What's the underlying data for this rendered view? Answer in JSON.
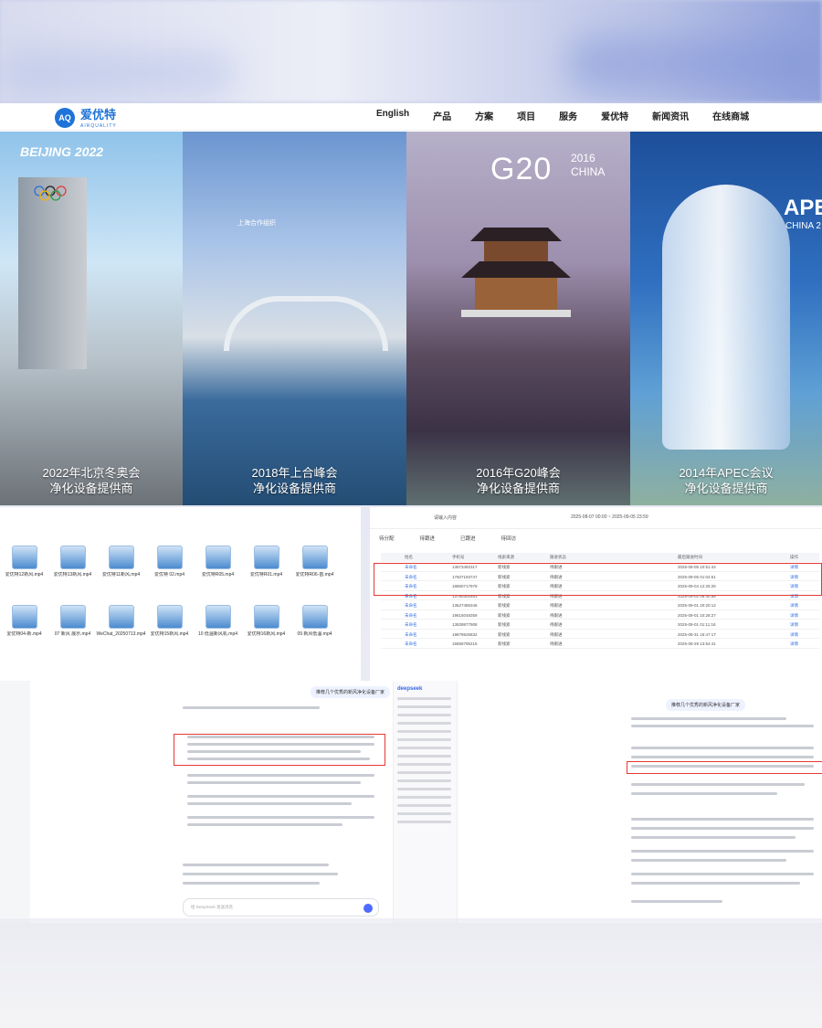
{
  "site": {
    "logo_name": "爱优特",
    "logo_sub": "AIRQUALITY",
    "logo_mark": "AQ",
    "menu": [
      "English",
      "产品",
      "方案",
      "项目",
      "服务",
      "爱优特",
      "新闻资讯",
      "在线商城"
    ]
  },
  "panels": [
    {
      "badge": "BEIJING 2022",
      "line1": "2022年北京冬奥会",
      "line2": "净化设备提供商"
    },
    {
      "badge": "上海合作组织",
      "line1": "2018年上合峰会",
      "line2": "净化设备提供商"
    },
    {
      "badge": "G20",
      "badge2": "2016 CHINA",
      "line1": "2016年G20峰会",
      "line2": "净化设备提供商"
    },
    {
      "badge": "APEC",
      "badge2": "CHINA 2",
      "line1": "2014年APEC会议",
      "line2": "净化设备提供商"
    }
  ],
  "files": [
    "爱优特12新风.mp4",
    "爱优特13新风.mp4",
    "爱优特11新风.mp4",
    "爱优特 02.mp4",
    "爱优特R05.mp4",
    "爱优特R01.mp4",
    "爱优特R06-首.mp4",
    "爱优特04-新.mp4",
    "07 新风 展示.mp4",
    "WeChat_20250713.mp4",
    "爱优特15新风.mp4",
    "10 低温新风机.mp4",
    "爱优特16新风.mp4",
    "09 新风低温.mp4"
  ],
  "crm": {
    "search_placeholder": "请输入内容",
    "date_range": "2025-08-07 00:00 ~ 2025-09-05 23:59",
    "tabs": [
      "待分配",
      "待跟进",
      "已跟进",
      "待回访"
    ],
    "columns": [
      "姓名",
      "手机号",
      "线索来源",
      "跟进状态",
      "最后跟进时间",
      "操作"
    ],
    "rows": [
      {
        "name": "未命名",
        "phone": "13573492317",
        "source": "新线索",
        "status": "待跟进",
        "time": "2025-09-05 10:51:44",
        "action": "详情"
      },
      {
        "name": "未命名",
        "phone": "17607193747",
        "source": "新线索",
        "status": "待跟进",
        "time": "2025-09-05 01:04:51",
        "action": "详情"
      },
      {
        "name": "未命名",
        "phone": "18860717979",
        "source": "新线索",
        "status": "待跟进",
        "time": "2025-09-04 12:25:25",
        "action": "详情"
      },
      {
        "name": "未命名",
        "phone": "13780302461",
        "source": "新线索",
        "status": "待跟进",
        "time": "2025-09-02 09:40:58",
        "action": "详情"
      },
      {
        "name": "未命名",
        "phone": "13527486346",
        "source": "新线索",
        "status": "待跟进",
        "time": "2025-09-01 20:20:12",
        "action": "详情"
      },
      {
        "name": "未命名",
        "phone": "19615048359",
        "source": "新线索",
        "status": "待跟进",
        "time": "2025-09-01 10:28:27",
        "action": "详情"
      },
      {
        "name": "未命名",
        "phone": "13839877908",
        "source": "新线索",
        "status": "待跟进",
        "time": "2025-09-01 01:11:18",
        "action": "详情"
      },
      {
        "name": "未命名",
        "phone": "19879526832",
        "source": "新线索",
        "status": "待跟进",
        "time": "2025-08-31 15:47:17",
        "action": "详情"
      },
      {
        "name": "未命名",
        "phone": "15858795215",
        "source": "新线索",
        "status": "待跟进",
        "time": "2025-08-29 13:54:41",
        "action": "详情"
      }
    ]
  },
  "chat1": {
    "question": "推荐几个优秀的新风净化设备厂家",
    "brand": "deepseek",
    "input_placeholder": "给 DeepSeek 发送消息"
  },
  "chat2": {
    "question": "推荐几个优秀的新风净化设备厂家"
  }
}
